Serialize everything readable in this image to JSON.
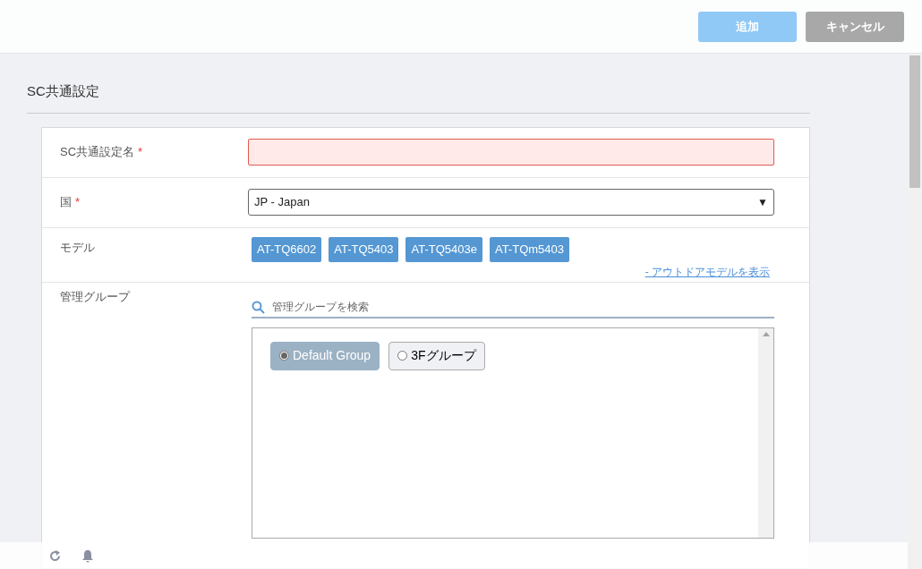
{
  "header": {
    "buttons": [
      {
        "label": "追加",
        "kind": "primary"
      },
      {
        "label": "キャンセル",
        "kind": "secondary"
      }
    ]
  },
  "section_title": "SC共通設定",
  "form": {
    "rows": [
      {
        "kind": "text",
        "label": "SC共通設定名",
        "required": "*",
        "invalid": true,
        "value": ""
      },
      {
        "kind": "select",
        "label": "国",
        "required": "*",
        "value": "JP - Japan",
        "arrow": "▼"
      },
      {
        "kind": "tags",
        "label": "モデル",
        "tags": [
          "AT-TQ6602",
          "AT-TQ5403",
          "AT-TQ5403e",
          "AT-TQm5403"
        ],
        "link": "- アウトドアモデルを表示"
      },
      {
        "kind": "groups",
        "label": "管理グループ",
        "search": {
          "placeholder": "管理グループを検索"
        },
        "groups": [
          {
            "label": "Default Group",
            "selected": true
          },
          {
            "label": "3Fグループ",
            "selected": false
          }
        ]
      }
    ]
  }
}
